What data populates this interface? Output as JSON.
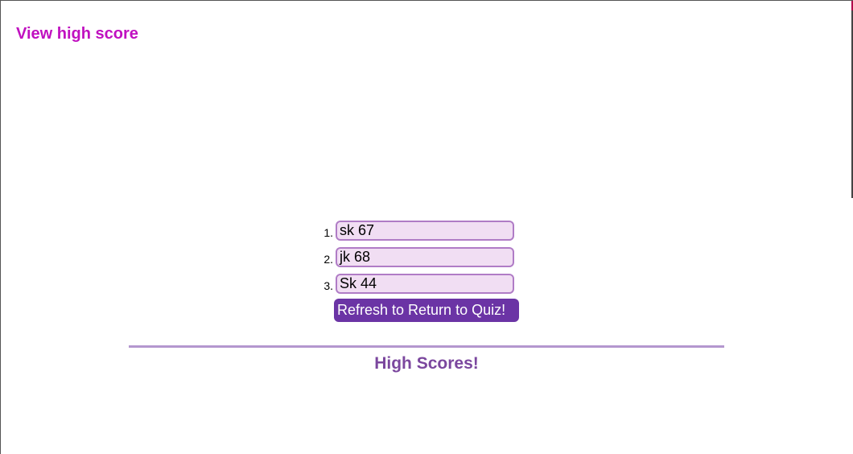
{
  "header": {
    "view_high_score_label": "View high score"
  },
  "scores": {
    "items": [
      {
        "rank": "1.",
        "value": "sk 67"
      },
      {
        "rank": "2.",
        "value": "jk 68"
      },
      {
        "rank": "3.",
        "value": "Sk 44"
      }
    ],
    "refresh_label": "Refresh to Return to Quiz!"
  },
  "footer": {
    "title": "High Scores!"
  },
  "colors": {
    "link": "#c010c0",
    "score_box_bg": "#f1def3",
    "score_box_border": "#b07cc6",
    "button_bg": "#6b34a5",
    "divider": "#b497cf",
    "title": "#7b479e"
  }
}
